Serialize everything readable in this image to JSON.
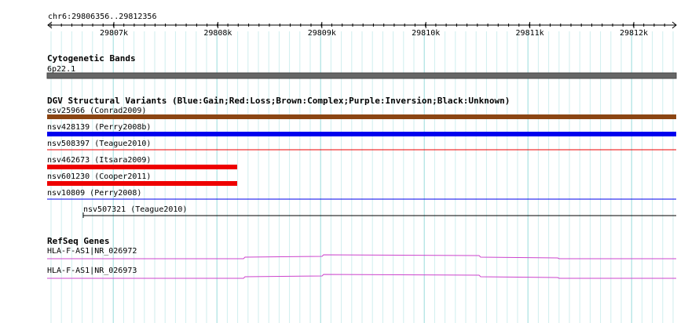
{
  "ruler": {
    "position_label": "chr6:29806356..29812356",
    "ticks": [
      "29807k",
      "29808k",
      "29809k",
      "29810k",
      "29811k",
      "29812k"
    ]
  },
  "tracks": {
    "cytoband": {
      "title": "Cytogenetic Bands",
      "band_label": "6p22.1",
      "color": "#666666"
    },
    "dgv": {
      "title": "DGV Structural Variants (Blue:Gain;Red:Loss;Brown:Complex;Purple:Inversion;Black:Unknown)",
      "features": [
        {
          "label": "esv25966 (Conrad2009)",
          "type": "Complex",
          "color": "#8b4513"
        },
        {
          "label": "nsv428139 (Perry2008b)",
          "type": "Gain",
          "color": "#0000ee"
        },
        {
          "label": "nsv508397 (Teague2010)",
          "type": "Loss",
          "color": "#ee0000"
        },
        {
          "label": "nsv462673 (Itsara2009)",
          "type": "Loss",
          "color": "#ee0000"
        },
        {
          "label": "nsv601230 (Cooper2011)",
          "type": "Loss",
          "color": "#ee0000"
        },
        {
          "label": "nsv10809 (Perry2008)",
          "type": "Gain",
          "color": "#0000ee"
        },
        {
          "label": "nsv507321 (Teague2010)",
          "type": "Unknown",
          "color": "#000000"
        }
      ]
    },
    "refseq": {
      "title": "RefSeq Genes",
      "genes": [
        {
          "label": "HLA-F-AS1|NR_026972",
          "color": "#cc44cc"
        },
        {
          "label": "HLA-F-AS1|NR_026973",
          "color": "#cc44cc"
        }
      ]
    }
  }
}
